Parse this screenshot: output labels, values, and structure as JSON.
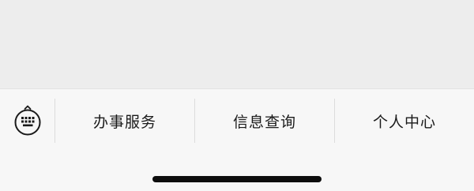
{
  "keyboard_toggle": {
    "icon": "keyboard-icon"
  },
  "menu": {
    "items": [
      {
        "label": "办事服务"
      },
      {
        "label": "信息查询"
      },
      {
        "label": "个人中心"
      }
    ]
  },
  "colors": {
    "background": "#ededed",
    "menu_bar": "#f7f7f7",
    "text": "#1a1a1a",
    "divider": "#dcdcdc",
    "home_indicator": "#0d0d0d"
  }
}
